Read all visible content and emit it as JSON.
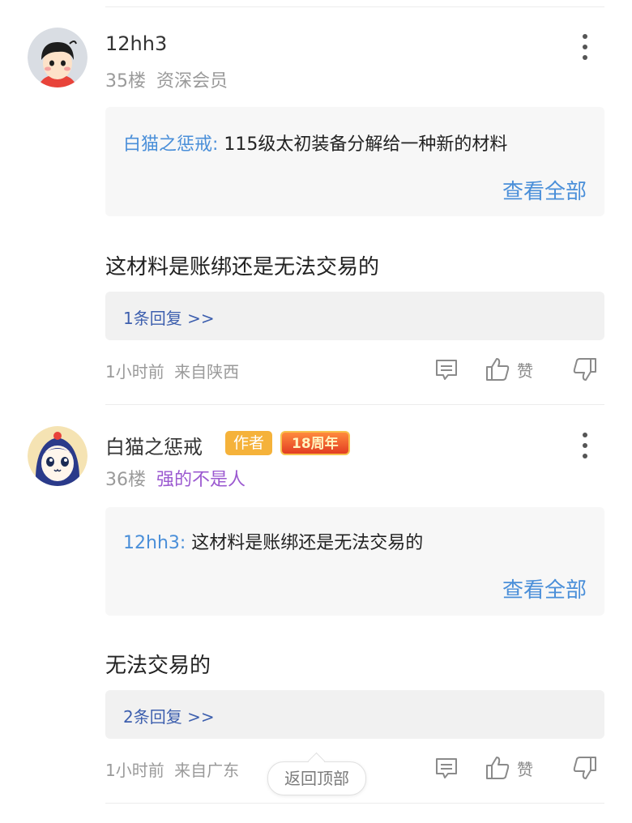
{
  "posts": [
    {
      "username": "12hh3",
      "floor": "35楼",
      "level": "资深会员",
      "quote_author": "白猫之惩戒:",
      "quote_text": "115级太初装备分解给一种新的材料",
      "view_all": "查看全部",
      "content": "这材料是账绑还是无法交易的",
      "reply_count": "1条回复 >>",
      "time": "1小时前",
      "location": "来自陕西",
      "like_label": "赞"
    },
    {
      "username": "白猫之惩戒",
      "author_badge": "作者",
      "anniversary_badge": "18周年",
      "floor": "36楼",
      "level": "强的不是人",
      "quote_author": "12hh3:",
      "quote_text": "这材料是账绑还是无法交易的",
      "view_all": "查看全部",
      "content": "无法交易的",
      "reply_count": "2条回复 >>",
      "time": "1小时前",
      "location": "来自广东",
      "like_label": "赞"
    }
  ],
  "back_to_top": "返回顶部",
  "colors": {
    "link_blue": "#4a8fd9",
    "reply_blue": "#3d5fae",
    "level_purple": "#9b59d0",
    "author_badge": "#f5b23a"
  },
  "icons": [
    "more-icon",
    "comment-icon",
    "thumbs-up-icon",
    "thumbs-down-icon"
  ]
}
